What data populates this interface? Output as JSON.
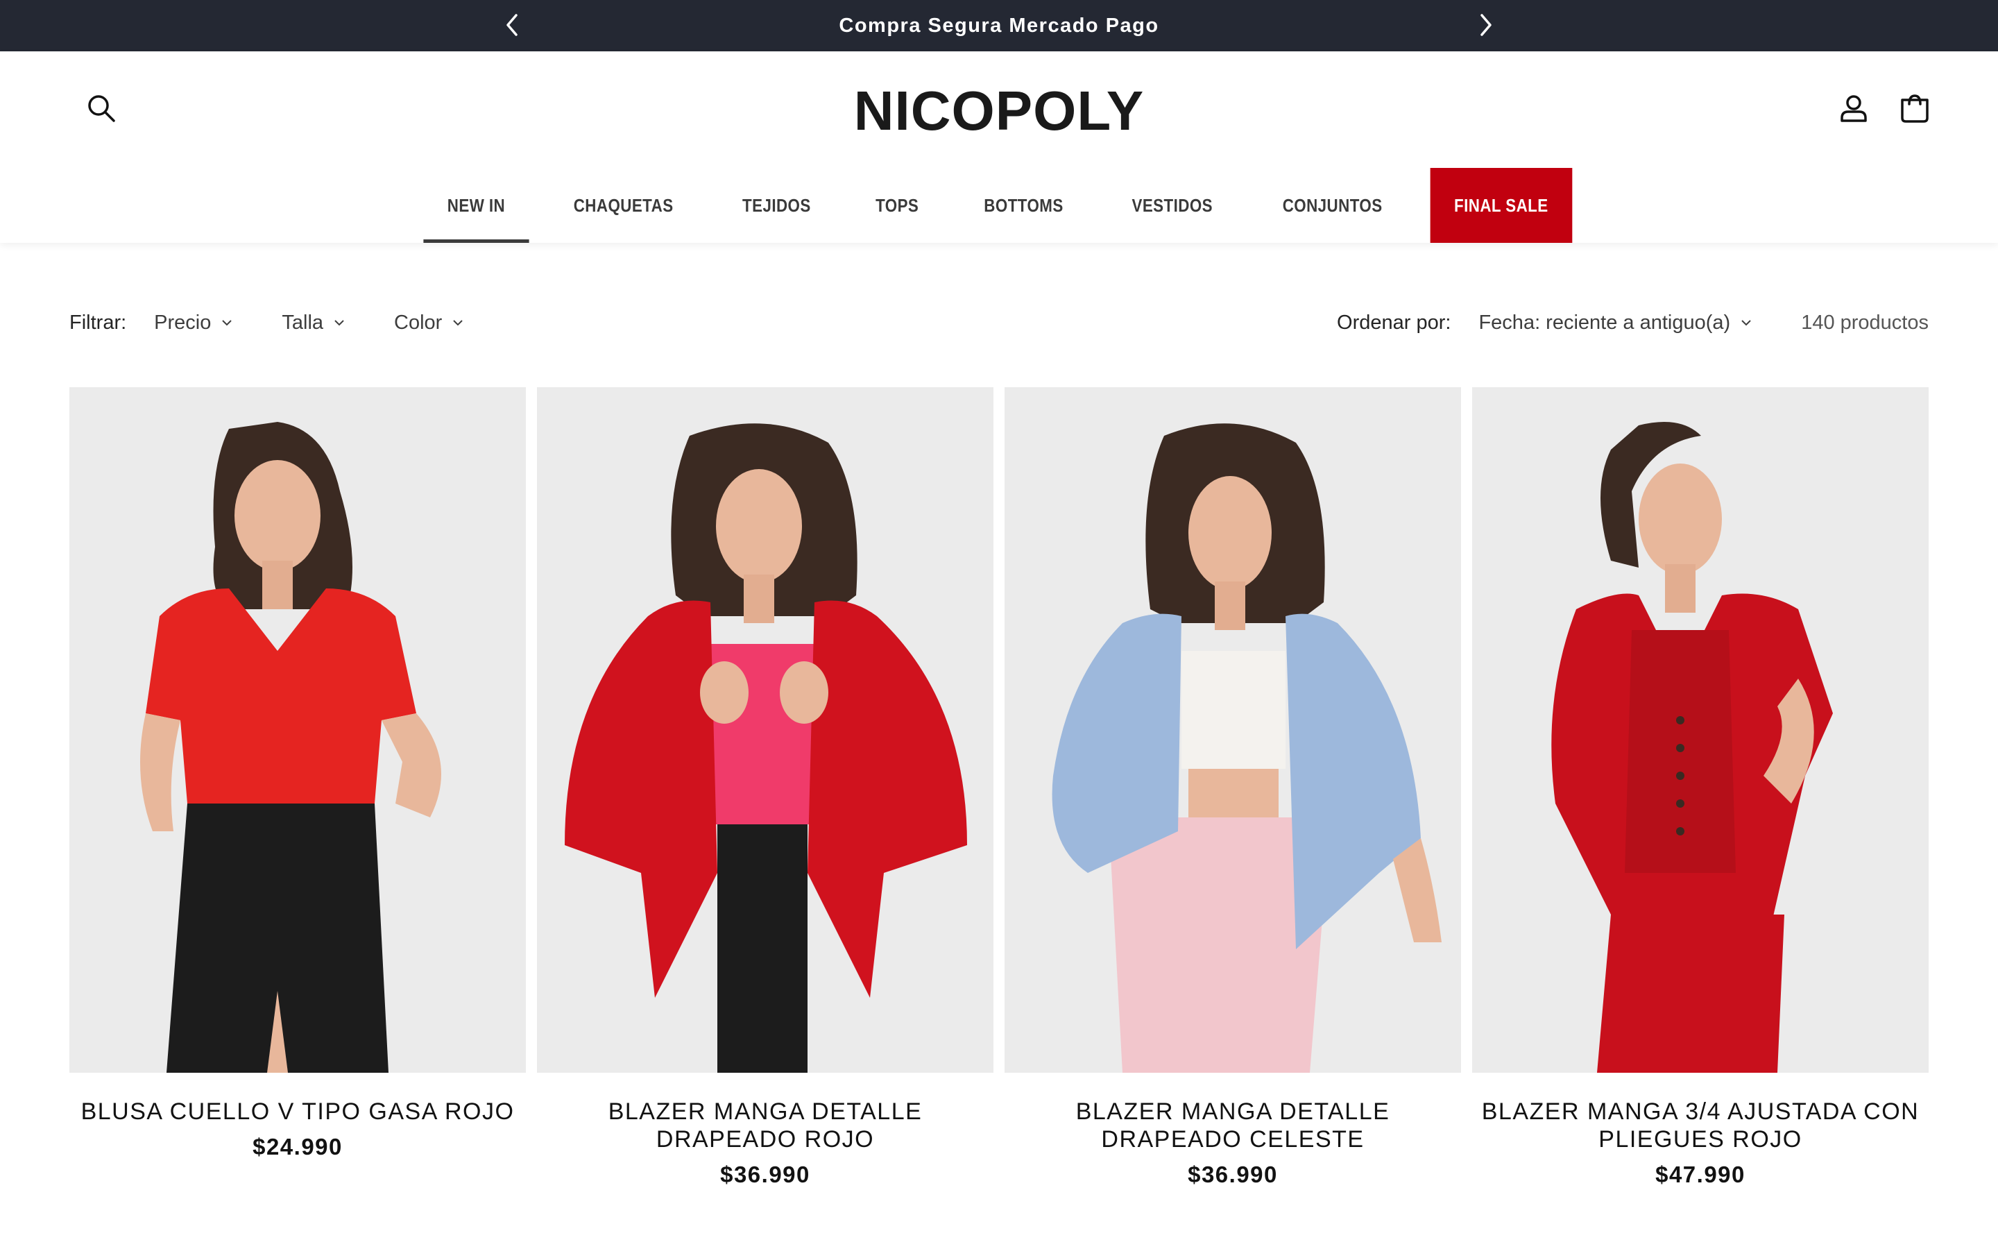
{
  "announcement": {
    "message": "Compra Segura Mercado Pago",
    "prev_icon": "chevron-left-icon",
    "next_icon": "chevron-right-icon"
  },
  "header": {
    "logo": "NICOPOLY",
    "icons": [
      "search-icon",
      "account-icon",
      "cart-icon"
    ]
  },
  "nav": {
    "items": [
      {
        "label": "NEW IN"
      },
      {
        "label": "CHAQUETAS"
      },
      {
        "label": "TEJIDOS"
      },
      {
        "label": "TOPS"
      },
      {
        "label": "BOTTOMS"
      },
      {
        "label": "VESTIDOS"
      },
      {
        "label": "CONJUNTOS"
      },
      {
        "label": "FINAL SALE"
      }
    ],
    "active": "NEW IN",
    "sale_color": "#c1000f"
  },
  "filters": {
    "label": "Filtrar:",
    "items": [
      {
        "label": "Precio"
      },
      {
        "label": "Talla"
      },
      {
        "label": "Color"
      }
    ]
  },
  "sort": {
    "label": "Ordenar por:",
    "selected": "Fecha: reciente a antiguo(a)",
    "count": "140 productos"
  },
  "products": [
    {
      "title": "BLUSA CUELLO V TIPO GASA ROJO",
      "price": "$24.990"
    },
    {
      "title": "BLAZER MANGA DETALLE DRAPEADO ROJO",
      "price": "$36.990"
    },
    {
      "title": "BLAZER MANGA DETALLE DRAPEADO CELESTE",
      "price": "$36.990"
    },
    {
      "title": "BLAZER MANGA 3/4 AJUSTADA CON PLIEGUES ROJO",
      "price": "$47.990"
    }
  ],
  "colors": {
    "announcement_bg": "#242833",
    "image_bg": "#ebebeb",
    "red_garment": "#d0121e",
    "blue_garment": "#9db8dc",
    "pink_garment": "#f2c6cc"
  }
}
